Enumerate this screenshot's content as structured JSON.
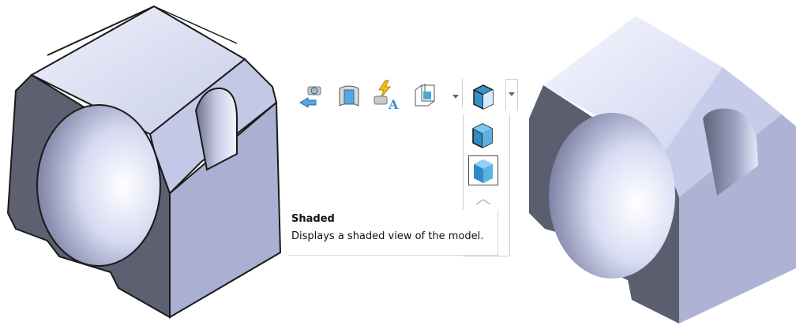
{
  "toolbar": {
    "buttons": [
      {
        "name": "view-orientation-button",
        "icon": "camera-arrow-icon"
      },
      {
        "name": "section-view-button",
        "icon": "section-view-icon"
      },
      {
        "name": "dynamic-annotation-views-button",
        "icon": "annotation-lightning-icon"
      },
      {
        "name": "view-palette-button",
        "icon": "view-settings-icon"
      },
      {
        "name": "display-style-button",
        "icon": "display-style-cube-icon"
      }
    ]
  },
  "display_style_menu": {
    "items": [
      {
        "name": "shaded-with-edges",
        "icon": "shaded-with-edges-cube-icon",
        "selected": false
      },
      {
        "name": "shaded",
        "icon": "shaded-cube-icon",
        "selected": true
      }
    ]
  },
  "tooltip": {
    "title": "Shaded",
    "description": "Displays a shaded view of the model."
  },
  "colors": {
    "model_light": "#d6dbf3",
    "model_dark": "#5b5e6e",
    "model_mid": "#9ea3c3",
    "edge": "#1a1a1a",
    "icon_blue": "#4aa7d8"
  }
}
